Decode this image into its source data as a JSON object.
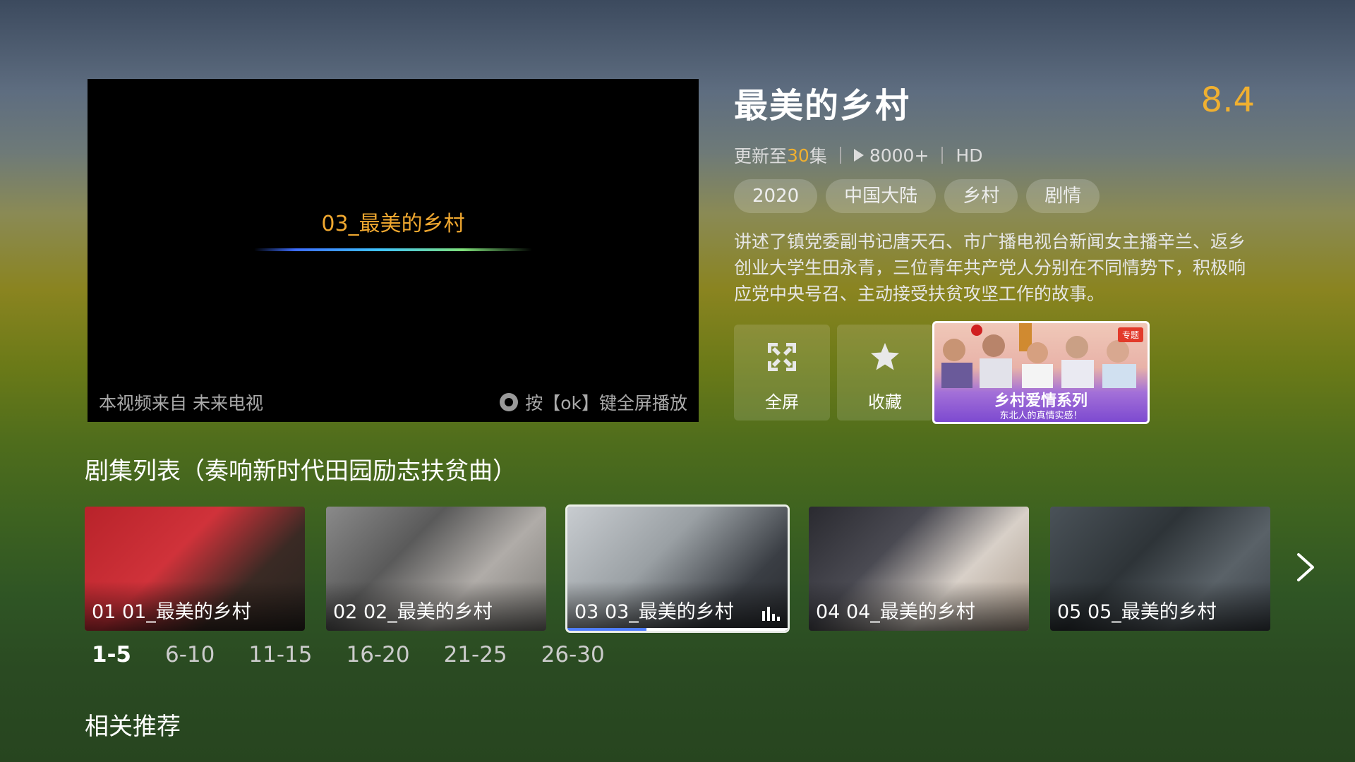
{
  "player": {
    "title": "03_最美的乡村",
    "source": "本视频来自 未来电视",
    "hint": "按【ok】键全屏播放"
  },
  "show": {
    "title": "最美的乡村",
    "rating": "8.4",
    "update_prefix": "更新至",
    "update_count": "30",
    "update_suffix": "集",
    "plays": "8000+",
    "quality": "HD",
    "tags": [
      "2020",
      "中国大陆",
      "乡村",
      "剧情"
    ],
    "description": "讲述了镇党委副书记唐天石、市广播电视台新闻女主播辛兰、返乡创业大学生田永青，三位青年共产党人分别在不同情势下，积极响应党中央号召、主动接受扶贫攻坚工作的故事。"
  },
  "actions": {
    "fullscreen_label": "全屏",
    "favorite_label": "收藏"
  },
  "promo": {
    "badge": "专题",
    "title": "乡村爱情系列",
    "subtitle": "东北人的真情实感！"
  },
  "episode_list": {
    "title": "剧集列表（奏响新时代田园励志扶贫曲）",
    "items": [
      {
        "label": "01 01_最美的乡村"
      },
      {
        "label": "02 02_最美的乡村"
      },
      {
        "label": "03 03_最美的乡村",
        "playing": true,
        "progress": 0.36
      },
      {
        "label": "04 04_最美的乡村"
      },
      {
        "label": "05 05_最美的乡村"
      }
    ],
    "ranges": [
      "1-5",
      "6-10",
      "11-15",
      "16-20",
      "21-25",
      "26-30"
    ],
    "active_range": "1-5"
  },
  "related": {
    "title": "相关推荐"
  },
  "colors": {
    "accent": "#f0b030",
    "progress": "#4f7dff"
  }
}
